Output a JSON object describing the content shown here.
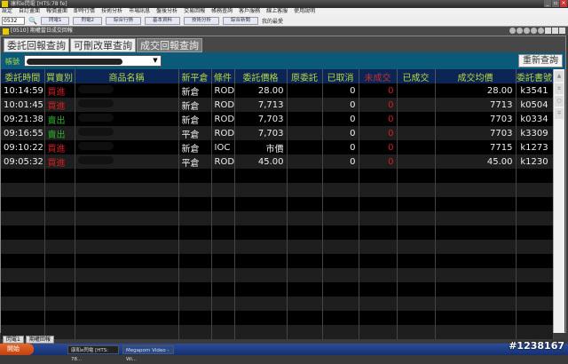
{
  "app": {
    "title": "康和e閃電 [HTS:78 fe]"
  },
  "menu": [
    "設定",
    "自訂畫面",
    "報價畫面",
    "即時行情",
    "技術分析",
    "市場訊息",
    "盤後分析",
    "交易回報",
    "帳務查詢",
    "客戶服務",
    "線上客服",
    "使用說明"
  ],
  "toolbar": {
    "code": "0532",
    "buttons": [
      "閃電1",
      "閃電2",
      "綜合行情",
      "基本資料",
      "技術分析",
      "綜合新聞"
    ],
    "favorite": "我的最愛"
  },
  "window": {
    "title": "[0510] 期權當日成交回報"
  },
  "tabs": [
    "委託回報查詢",
    "可刪改單查詢",
    "成交回報查詢"
  ],
  "account": {
    "label": "帳號",
    "refresh": "重新查詢"
  },
  "columns": [
    "委託時間",
    "買賣別",
    "商品名稱",
    "新平倉",
    "條件",
    "委託價格",
    "原委託",
    "已取消",
    "未成交",
    "已成交",
    "成交均價",
    "委託書號"
  ],
  "rows": [
    {
      "time": "10:14:59",
      "side": "買進",
      "oc": "新倉",
      "cond": "ROD",
      "price": "28.00",
      "cancel": "0",
      "unfilled": "0",
      "avg": "28.00",
      "no": "k3541"
    },
    {
      "time": "10:01:45",
      "side": "買進",
      "oc": "新倉",
      "cond": "ROD",
      "price": "7,713",
      "cancel": "0",
      "unfilled": "0",
      "avg": "7713",
      "no": "k0504"
    },
    {
      "time": "09:21:38",
      "side": "賣出",
      "oc": "新倉",
      "cond": "ROD",
      "price": "7,703",
      "cancel": "0",
      "unfilled": "0",
      "avg": "7703",
      "no": "k0334"
    },
    {
      "time": "09:16:55",
      "side": "賣出",
      "oc": "平倉",
      "cond": "ROD",
      "price": "7,703",
      "cancel": "0",
      "unfilled": "0",
      "avg": "7703",
      "no": "k3309"
    },
    {
      "time": "09:10:22",
      "side": "買進",
      "oc": "新倉",
      "cond": "IOC",
      "price": "市價",
      "cancel": "0",
      "unfilled": "0",
      "avg": "7715",
      "no": "k1273"
    },
    {
      "time": "09:05:32",
      "side": "買進",
      "oc": "平倉",
      "cond": "ROD",
      "price": "45.00",
      "cancel": "0",
      "unfilled": "0",
      "avg": "45.00",
      "no": "k1230"
    }
  ],
  "bottom_tabs": [
    "閃電1",
    "期權回報"
  ],
  "taskbar": {
    "start": "開始",
    "tasks": [
      "康和e閃電 [HTS: 78...",
      "Megaporn Video - Wi..."
    ]
  },
  "watermark": "#1238167"
}
